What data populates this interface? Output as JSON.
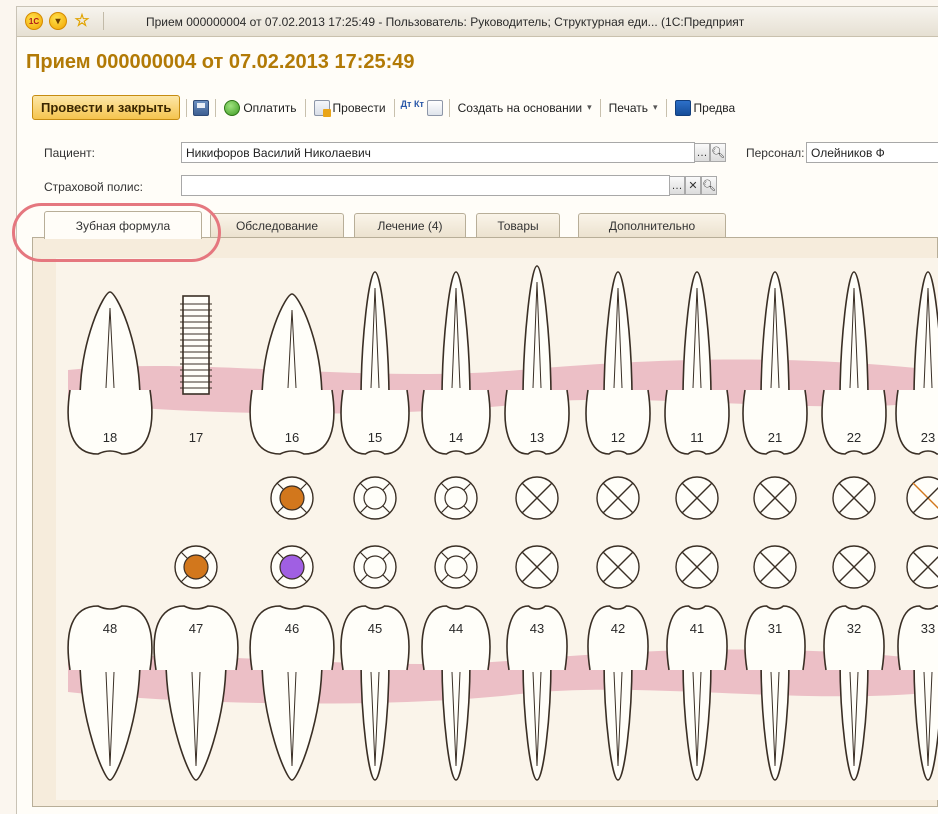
{
  "window": {
    "title": "Прием 000000004 от 07.02.2013 17:25:49 - Пользователь: Руководитель;  Структурная еди...  (1С:Предприят"
  },
  "document": {
    "header": "Прием 000000004 от 07.02.2013 17:25:49"
  },
  "toolbar": {
    "post_close_label": "Провести и закрыть",
    "pay_label": "Оплатить",
    "post_label": "Провести",
    "dtkt_label": "Дт Кт",
    "create_basis_label": "Создать на основании",
    "print_label": "Печать",
    "preview_label": "Предва"
  },
  "fields": {
    "patient_label": "Пациент:",
    "patient_value": "Никифоров Василий Николаевич",
    "staff_label": "Персонал:",
    "staff_value": "Олейников Ф",
    "policy_label": "Страховой полис:",
    "policy_value": ""
  },
  "tabs": [
    {
      "label": "Зубная формула",
      "active": true
    },
    {
      "label": "Обследование",
      "active": false
    },
    {
      "label": "Лечение (4)",
      "active": false
    },
    {
      "label": "Товары",
      "active": false
    },
    {
      "label": "Дополнительно",
      "active": false
    }
  ],
  "dental_chart": {
    "upper_teeth": [
      "18",
      "17",
      "16",
      "15",
      "14",
      "13",
      "12",
      "11",
      "21",
      "22",
      "23"
    ],
    "lower_teeth": [
      "48",
      "47",
      "46",
      "45",
      "44",
      "43",
      "42",
      "41",
      "31",
      "32",
      "33"
    ],
    "upper_markers": [
      "none",
      "none",
      "filled-orange",
      "ring",
      "ring",
      "cross",
      "cross",
      "cross",
      "cross",
      "cross",
      "cross-orange"
    ],
    "lower_markers": [
      "none",
      "filled-orange",
      "filled-purple",
      "ring",
      "ring",
      "cross",
      "cross",
      "cross",
      "cross",
      "cross",
      "cross"
    ],
    "colors": {
      "orange": "#d2771c",
      "purple": "#a05fe3",
      "gum": "#ecbfc6",
      "highlight": "#e5777f"
    }
  }
}
